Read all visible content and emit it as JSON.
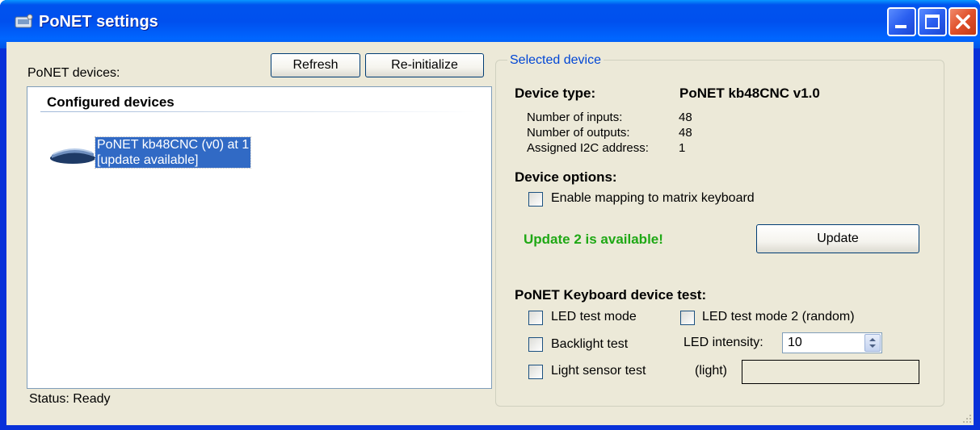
{
  "window": {
    "title": "PoNET settings"
  },
  "left": {
    "devices_label": "PoNET devices:",
    "refresh_label": "Refresh",
    "reinit_label": "Re-initialize",
    "group_header": "Configured devices",
    "device_line1": "PoNET kb48CNC (v0) at 1",
    "device_line2": "[update available]",
    "status": "Status: Ready"
  },
  "right": {
    "group_title": "Selected device",
    "device_type_label": "Device type:",
    "device_type_value": "PoNET kb48CNC v1.0",
    "inputs_label": "Number of inputs:",
    "inputs_value": "48",
    "outputs_label": "Number of outputs:",
    "outputs_value": "48",
    "i2c_label": "Assigned I2C address:",
    "i2c_value": "1",
    "options_title": "Device options:",
    "enable_mapping_label": "Enable mapping to matrix keyboard",
    "update_available_text": "Update 2 is available!",
    "update_button": "Update",
    "test_title": "PoNET Keyboard device test:",
    "led_test_label": "LED test mode",
    "led_test2_label": "LED test mode 2 (random)",
    "backlight_label": "Backlight test",
    "led_intensity_label": "LED intensity:",
    "led_intensity_value": "10",
    "light_sensor_label": "Light sensor test",
    "light_label": "(light)",
    "light_value": ""
  },
  "colors": {
    "title_blue": "#0054e3",
    "update_green": "#1fa815",
    "selected_blue": "#316ac5",
    "groupbox_title": "#0046d5"
  },
  "checkboxes": {
    "enable_mapping": false,
    "led_test": false,
    "led_test2": false,
    "backlight": false,
    "light_sensor": false
  }
}
